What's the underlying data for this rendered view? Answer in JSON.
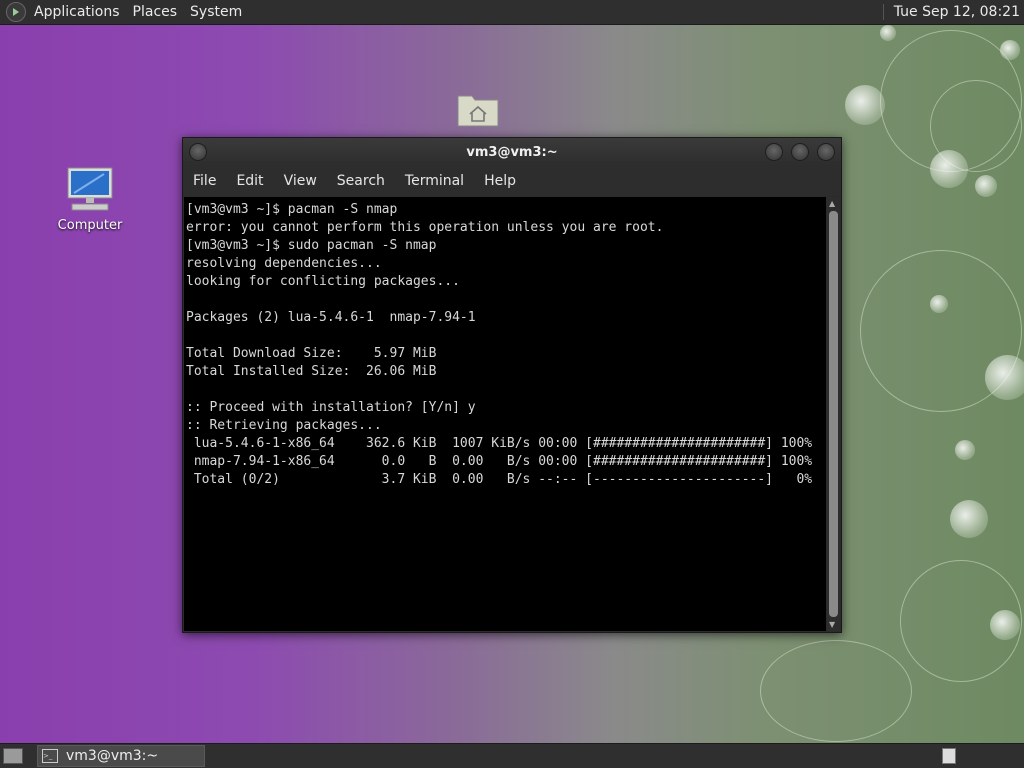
{
  "top_panel": {
    "menus": [
      "Applications",
      "Places",
      "System"
    ],
    "clock": "Tue Sep 12, 08:21"
  },
  "desktop": {
    "computer_label": "Computer"
  },
  "terminal": {
    "title": "vm3@vm3:~",
    "menu": [
      "File",
      "Edit",
      "View",
      "Search",
      "Terminal",
      "Help"
    ],
    "lines": [
      "[vm3@vm3 ~]$ pacman -S nmap",
      "error: you cannot perform this operation unless you are root.",
      "[vm3@vm3 ~]$ sudo pacman -S nmap",
      "resolving dependencies...",
      "looking for conflicting packages...",
      "",
      "Packages (2) lua-5.4.6-1  nmap-7.94-1",
      "",
      "Total Download Size:    5.97 MiB",
      "Total Installed Size:  26.06 MiB",
      "",
      ":: Proceed with installation? [Y/n] y",
      ":: Retrieving packages...",
      " lua-5.4.6-1-x86_64    362.6 KiB  1007 KiB/s 00:00 [######################] 100%",
      " nmap-7.94-1-x86_64      0.0   B  0.00   B/s 00:00 [######################] 100%",
      " Total (0/2)             3.7 KiB  0.00   B/s --:-- [----------------------]   0%"
    ]
  },
  "taskbar": {
    "window_label": "vm3@vm3:~"
  },
  "icons": {
    "menu_logo": "distro-logo-icon",
    "computer": "computer-icon",
    "home": "home-folder-icon",
    "show_desktop": "show-desktop-icon",
    "terminal": "terminal-icon"
  }
}
